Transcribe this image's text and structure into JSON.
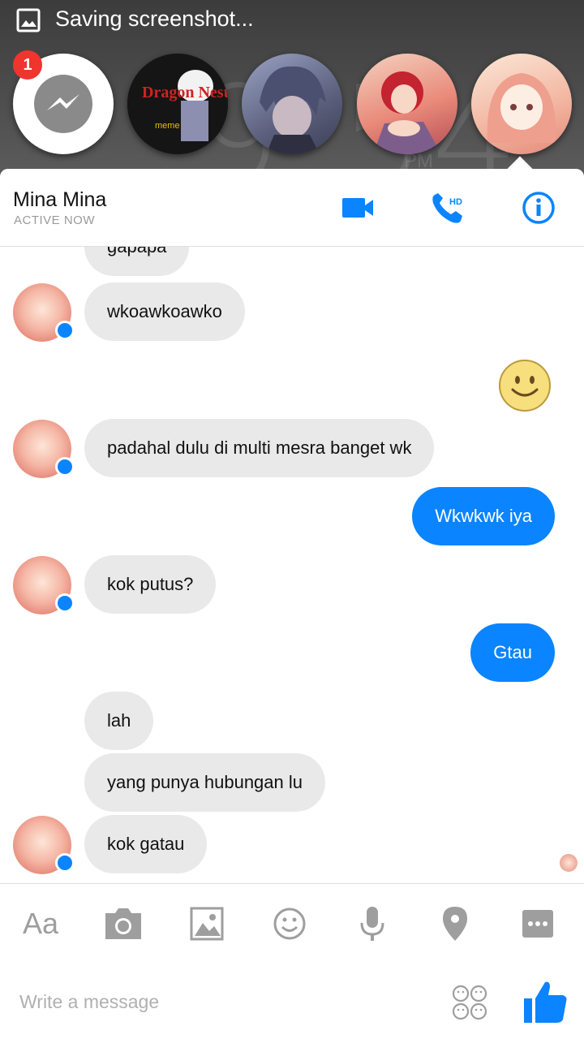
{
  "statusbar": {
    "notification_text": "Saving screenshot..."
  },
  "wallpaper": {
    "clock": "9:54",
    "ampm": "PM"
  },
  "chat_heads": [
    {
      "name": "messenger-app",
      "badge": "1"
    },
    {
      "name": "dragon-nest",
      "title": "Dragon Nest",
      "subtitle": "meme"
    },
    {
      "name": "contact-boy"
    },
    {
      "name": "contact-red"
    },
    {
      "name": "contact-pink-active"
    }
  ],
  "header": {
    "name": "Mina Mina",
    "status": "ACTIVE NOW"
  },
  "messages": [
    {
      "dir": "in",
      "text": "gapapa"
    },
    {
      "dir": "in",
      "text": "wkoawkoawko"
    },
    {
      "dir": "out",
      "type": "emoji",
      "text": "smiley"
    },
    {
      "dir": "in",
      "text": "padahal dulu di multi mesra banget wk"
    },
    {
      "dir": "out",
      "text": "Wkwkwk iya"
    },
    {
      "dir": "in",
      "text": "kok putus?"
    },
    {
      "dir": "out",
      "text": "Gtau"
    },
    {
      "dir": "in",
      "text": "lah"
    },
    {
      "dir": "in",
      "text": "yang punya hubungan lu"
    },
    {
      "dir": "in",
      "text": "kok gatau"
    }
  ],
  "composer": {
    "aa_label": "Aa",
    "placeholder": "Write a message",
    "icons": [
      "camera-icon",
      "image-icon",
      "emoji-icon",
      "mic-icon",
      "location-icon",
      "more-icon",
      "stickers-icon",
      "like-icon"
    ]
  },
  "colors": {
    "accent": "#0a84ff",
    "incoming_bubble": "#e9e9e9",
    "badge": "#f0342e"
  }
}
